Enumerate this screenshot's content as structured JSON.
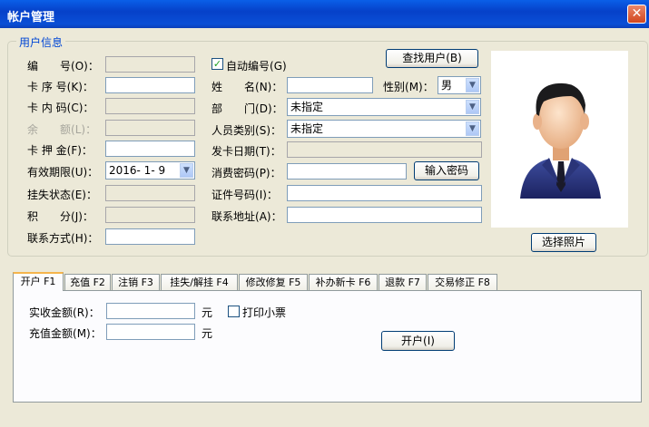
{
  "window": {
    "title": "帐户管理",
    "close_glyph": "✕"
  },
  "group": {
    "title": "用户信息"
  },
  "fields": {
    "bianhao": {
      "label": "编　　号",
      "hotkey": "(O)：",
      "value": ""
    },
    "kaxuhao": {
      "label": "卡 序 号",
      "hotkey": "(K)：",
      "value": ""
    },
    "kaneima": {
      "label": "卡 内 码",
      "hotkey": "(C)：",
      "value": ""
    },
    "yue": {
      "label": "余　　额",
      "hotkey": "(L)：",
      "value": ""
    },
    "kayajin": {
      "label": "卡 押 金",
      "hotkey": "(F)：",
      "value": ""
    },
    "youxiao": {
      "label": "有效期限",
      "hotkey": "(U)：",
      "value": "2016- 1- 9"
    },
    "guashi": {
      "label": "挂失状态",
      "hotkey": "(E)：",
      "value": ""
    },
    "jifen": {
      "label": "积　　分",
      "hotkey": "(J)：",
      "value": ""
    },
    "lianxi": {
      "label": "联系方式",
      "hotkey": "(H)：",
      "value": ""
    },
    "auto_number": {
      "label": "自动编号",
      "hotkey": "(G)",
      "checked": true
    },
    "xingming": {
      "label": "姓　　名",
      "hotkey": "(N)：",
      "value": ""
    },
    "xingbie": {
      "label": "性别",
      "hotkey": "(M)：",
      "value": "男"
    },
    "bumen": {
      "label": "部　　门",
      "hotkey": "(D)：",
      "value": "未指定"
    },
    "renyuan": {
      "label": "人员类别",
      "hotkey": "(S)：",
      "value": "未指定"
    },
    "fakariqi": {
      "label": "发卡日期",
      "hotkey": "(T)：",
      "value": ""
    },
    "xiaofei": {
      "label": "消费密码",
      "hotkey": "(P)：",
      "value": ""
    },
    "zhengjian": {
      "label": "证件号码",
      "hotkey": "(I)：",
      "value": ""
    },
    "dizhi": {
      "label": "联系地址",
      "hotkey": "(A)：",
      "value": ""
    }
  },
  "buttons": {
    "find_user": "查找用户(B)",
    "enter_password": "输入密码",
    "choose_photo": "选择照片",
    "open_account": "开户(I)"
  },
  "tabs": [
    "开户 F1",
    "充值 F2",
    "注销 F3",
    "挂失/解挂 F4",
    "修改修复 F5",
    "补办新卡 F6",
    "退款 F7",
    "交易修正 F8"
  ],
  "panel": {
    "received": {
      "label": "实收金额",
      "hotkey": "(R)：",
      "value": "",
      "unit": "元"
    },
    "recharge": {
      "label": "充值金额",
      "hotkey": "(M)：",
      "value": "",
      "unit": "元"
    },
    "print_receipt": {
      "label": "打印小票",
      "checked": false
    }
  }
}
